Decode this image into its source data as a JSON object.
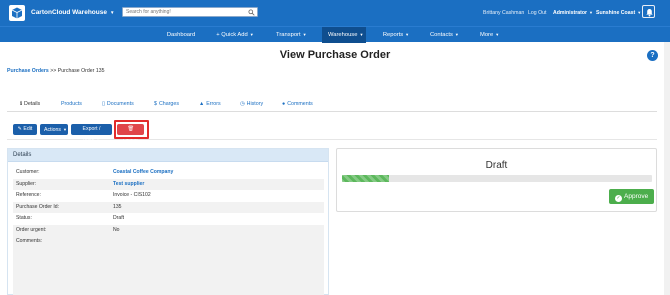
{
  "header": {
    "app_name": "CartonCloud Warehouse",
    "search_placeholder": "Search for anything!",
    "user_name": "Brittany Cashman",
    "logout": "Log Out",
    "role": "Administrator",
    "company": "Sunshine Coast",
    "brand_color": "#1b6fc2"
  },
  "nav": {
    "items": [
      {
        "label": "Dashboard"
      },
      {
        "label": "+ Quick Add"
      },
      {
        "label": "Transport"
      },
      {
        "label": "Warehouse"
      },
      {
        "label": "Reports"
      },
      {
        "label": "Contacts"
      },
      {
        "label": "More"
      }
    ]
  },
  "page": {
    "title": "View Purchase Order",
    "help": "?",
    "breadcrumb_link": "Purchase Orders",
    "breadcrumb_sep": ">>",
    "breadcrumb_current": "Purchase Order 135"
  },
  "tabs": [
    {
      "label": "Details",
      "icon": "info-icon"
    },
    {
      "label": "Products",
      "icon": ""
    },
    {
      "label": "Documents",
      "icon": "document-icon"
    },
    {
      "label": "Charges",
      "icon": "dollar-icon"
    },
    {
      "label": "Errors",
      "icon": "warning-icon"
    },
    {
      "label": "History",
      "icon": "clock-icon"
    },
    {
      "label": "Comments",
      "icon": "comment-icon"
    }
  ],
  "actions": {
    "edit": "Edit",
    "actions": "Actions",
    "export": "Export / View",
    "delete": "Delete"
  },
  "details": {
    "heading": "Details",
    "rows": [
      {
        "label": "Customer:",
        "value": "Coastal Coffee Company"
      },
      {
        "label": "Supplier:",
        "value": "Test supplier"
      },
      {
        "label": "Reference:",
        "value": "Invoice - CIS102"
      },
      {
        "label": "Purchase Order Id:",
        "value": "135"
      },
      {
        "label": "Status:",
        "value": "Draft"
      },
      {
        "label": "Order urgent:",
        "value": "No"
      }
    ],
    "comments_label": "Comments:"
  },
  "status": {
    "title": "Draft",
    "progress_fraction": 0.15,
    "approve": "Approve"
  }
}
